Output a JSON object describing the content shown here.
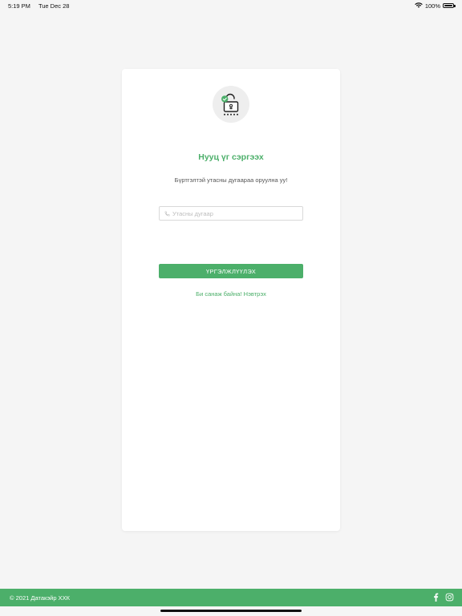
{
  "status_bar": {
    "time": "5:19 PM",
    "date": "Tue Dec 28",
    "battery_text": "100%",
    "battery_level": 1.0
  },
  "form": {
    "title": "Нууц үг сэргээх",
    "subtitle": "Бүртгэлтэй утасны дугаараа оруулна уу!",
    "phone_placeholder": "Утасны дугаар",
    "phone_value": "",
    "continue_label": "ҮРГЭЛЖЛҮҮЛЭХ",
    "remember_text": "Би санаж байна!",
    "login_label": "Нэвтрэх"
  },
  "footer": {
    "copyright": "© 2021 Датакэйр ХХК",
    "icons": [
      "facebook-icon",
      "instagram-icon"
    ]
  },
  "colors": {
    "accent": "#4caf6a",
    "background": "#f5f5f5",
    "card": "#ffffff"
  }
}
